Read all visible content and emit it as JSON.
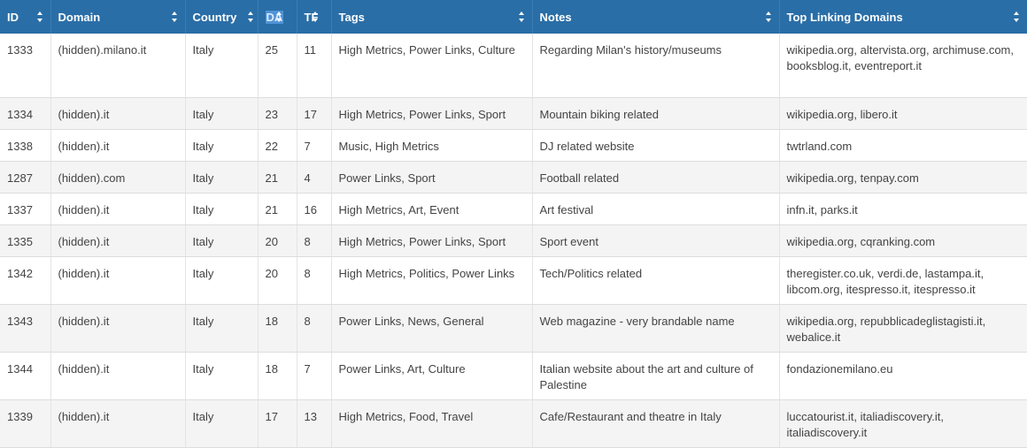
{
  "table": {
    "headers": [
      "ID",
      "Domain",
      "Country",
      "DA",
      "TF",
      "Tags",
      "Notes",
      "Top Linking Domains"
    ],
    "rows": [
      {
        "id": "1333",
        "domain": "(hidden).milano.it",
        "country": "Italy",
        "da": "25",
        "tf": "11",
        "tags": "High Metrics, Power Links, Culture",
        "notes": "Regarding Milan's history/museums",
        "links": "wikipedia.org, altervista.org, archimuse.com, booksblog.it, eventreport.it"
      },
      {
        "id": "1334",
        "domain": "(hidden).it",
        "country": "Italy",
        "da": "23",
        "tf": "17",
        "tags": "High Metrics, Power Links, Sport",
        "notes": "Mountain biking related",
        "links": "wikipedia.org, libero.it"
      },
      {
        "id": "1338",
        "domain": "(hidden).it",
        "country": "Italy",
        "da": "22",
        "tf": "7",
        "tags": "Music, High Metrics",
        "notes": "DJ related website",
        "links": "twtrland.com"
      },
      {
        "id": "1287",
        "domain": "(hidden).com",
        "country": "Italy",
        "da": "21",
        "tf": "4",
        "tags": "Power Links, Sport",
        "notes": "Football related",
        "links": "wikipedia.org, tenpay.com"
      },
      {
        "id": "1337",
        "domain": "(hidden).it",
        "country": "Italy",
        "da": "21",
        "tf": "16",
        "tags": "High Metrics, Art, Event",
        "notes": "Art festival",
        "links": "infn.it, parks.it"
      },
      {
        "id": "1335",
        "domain": "(hidden).it",
        "country": "Italy",
        "da": "20",
        "tf": "8",
        "tags": "High Metrics, Power Links, Sport",
        "notes": "Sport event",
        "links": "wikipedia.org, cqranking.com"
      },
      {
        "id": "1342",
        "domain": "(hidden).it",
        "country": "Italy",
        "da": "20",
        "tf": "8",
        "tags": "High Metrics, Politics, Power Links",
        "notes": "Tech/Politics related",
        "links": "theregister.co.uk, verdi.de, lastampa.it, libcom.org, itespresso.it, itespresso.it"
      },
      {
        "id": "1343",
        "domain": "(hidden).it",
        "country": "Italy",
        "da": "18",
        "tf": "8",
        "tags": "Power Links, News, General",
        "notes": "Web magazine - very brandable name",
        "links": "wikipedia.org, repubblicadeglistagisti.it, webalice.it"
      },
      {
        "id": "1344",
        "domain": "(hidden).it",
        "country": "Italy",
        "da": "18",
        "tf": "7",
        "tags": "Power Links, Art, Culture",
        "notes": "Italian website about the art and culture of Palestine",
        "links": "fondazionemilano.eu"
      },
      {
        "id": "1339",
        "domain": "(hidden).it",
        "country": "Italy",
        "da": "17",
        "tf": "13",
        "tags": "High Metrics, Food, Travel",
        "notes": "Cafe/Restaurant and theatre in Italy",
        "links": "luccatourist.it, italiadiscovery.it, italiadiscovery.it"
      }
    ]
  }
}
